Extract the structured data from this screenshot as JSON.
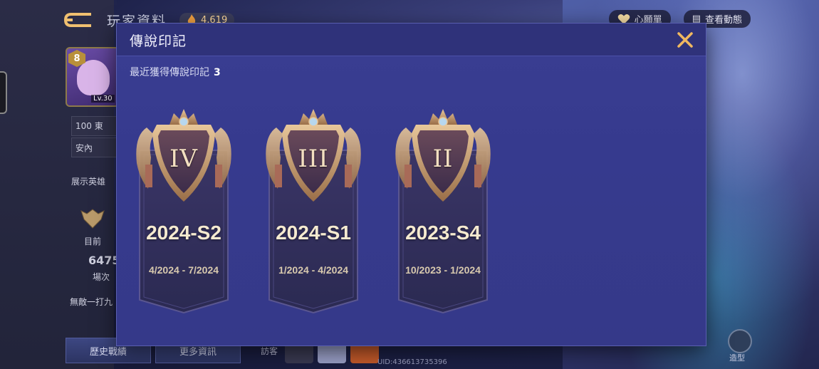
{
  "background": {
    "title": "玩家資料",
    "coins": "4,619",
    "wishlist_label": "心願單",
    "feed_label": "查看動態",
    "level_badge": "8",
    "avatar_level": "Lv.30",
    "currency_row": "100 東",
    "status": "安內",
    "showcase_label": "展示英雄",
    "current_label": "目前",
    "matches_value": "6475",
    "matches_label": "場次",
    "streak_label": "無敵一打九",
    "history_button": "歷史戰績",
    "more_button": "更多資訊",
    "visitors_label": "訪客",
    "uid": "UID:436613735396",
    "hero_label": "造型"
  },
  "modal": {
    "title": "傳說印記",
    "subtitle": "最近獲得傳說印記",
    "count": "3",
    "close_icon": "close-icon",
    "accent_color": "#f0b860",
    "cards": [
      {
        "numeral": "IV",
        "season": "2024-S2",
        "range": "4/2024 - 7/2024"
      },
      {
        "numeral": "III",
        "season": "2024-S1",
        "range": "1/2024 - 4/2024"
      },
      {
        "numeral": "II",
        "season": "2023-S4",
        "range": "10/2023 - 1/2024"
      }
    ]
  }
}
